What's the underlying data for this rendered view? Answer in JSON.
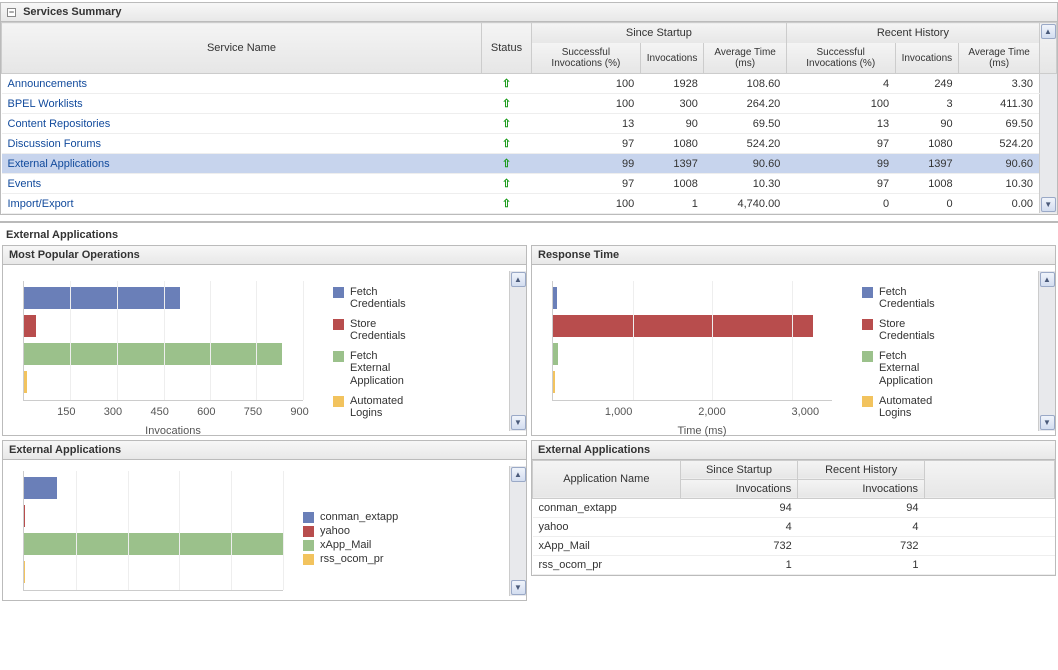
{
  "summary": {
    "title": "Services Summary",
    "columns": {
      "svc": "Service Name",
      "status": "Status",
      "since": "Since Startup",
      "recent": "Recent History",
      "succ": "Successful Invocations (%)",
      "inv": "Invocations",
      "avg": "Average Time (ms)"
    },
    "rows": [
      {
        "name": "Announcements",
        "succ_s": "100",
        "inv_s": "1928",
        "avg_s": "108.60",
        "succ_r": "4",
        "inv_r": "249",
        "avg_r": "3.30",
        "sel": false
      },
      {
        "name": "BPEL Worklists",
        "succ_s": "100",
        "inv_s": "300",
        "avg_s": "264.20",
        "succ_r": "100",
        "inv_r": "3",
        "avg_r": "411.30",
        "sel": false
      },
      {
        "name": "Content Repositories",
        "succ_s": "13",
        "inv_s": "90",
        "avg_s": "69.50",
        "succ_r": "13",
        "inv_r": "90",
        "avg_r": "69.50",
        "sel": false
      },
      {
        "name": "Discussion Forums",
        "succ_s": "97",
        "inv_s": "1080",
        "avg_s": "524.20",
        "succ_r": "97",
        "inv_r": "1080",
        "avg_r": "524.20",
        "sel": false
      },
      {
        "name": "External Applications",
        "succ_s": "99",
        "inv_s": "1397",
        "avg_s": "90.60",
        "succ_r": "99",
        "inv_r": "1397",
        "avg_r": "90.60",
        "sel": true
      },
      {
        "name": "Events",
        "succ_s": "97",
        "inv_s": "1008",
        "avg_s": "10.30",
        "succ_r": "97",
        "inv_r": "1008",
        "avg_r": "10.30",
        "sel": false
      },
      {
        "name": "Import/Export",
        "succ_s": "100",
        "inv_s": "1",
        "avg_s": "4,740.00",
        "succ_r": "0",
        "inv_r": "0",
        "avg_r": "0.00",
        "sel": false
      }
    ]
  },
  "section": {
    "title": "External Applications"
  },
  "popular": {
    "title": "Most Popular Operations",
    "axis": "Invocations",
    "ticks": [
      "150",
      "300",
      "450",
      "600",
      "750",
      "900"
    ],
    "legend": [
      {
        "cls": "c-fetch-cred",
        "label": "Fetch Credentials"
      },
      {
        "cls": "c-store-cred",
        "label": "Store Credentials"
      },
      {
        "cls": "c-fetch-ext",
        "label": "Fetch External Application"
      },
      {
        "cls": "c-auto-login",
        "label": "Automated Logins"
      }
    ]
  },
  "response": {
    "title": "Response Time",
    "axis": "Time (ms)",
    "ticks": [
      "1,000",
      "2,000",
      "3,000"
    ],
    "legend": [
      {
        "cls": "c-fetch-cred",
        "label": "Fetch Credentials"
      },
      {
        "cls": "c-store-cred",
        "label": "Store Credentials"
      },
      {
        "cls": "c-fetch-ext",
        "label": "Fetch External Application"
      },
      {
        "cls": "c-auto-login",
        "label": "Automated Logins"
      }
    ]
  },
  "extapps_chart": {
    "title": "External Applications",
    "legend": [
      {
        "cls": "c-conman",
        "label": "conman_extapp"
      },
      {
        "cls": "c-yahoo",
        "label": "yahoo"
      },
      {
        "cls": "c-xapp",
        "label": "xApp_Mail"
      },
      {
        "cls": "c-rss",
        "label": "rss_ocom_pr"
      }
    ]
  },
  "extapps_table": {
    "title": "External Applications",
    "cols": {
      "app": "Application Name",
      "since": "Since Startup",
      "recent": "Recent History",
      "inv": "Invocations"
    },
    "rows": [
      {
        "name": "conman_extapp",
        "s": "94",
        "r": "94"
      },
      {
        "name": "yahoo",
        "s": "4",
        "r": "4"
      },
      {
        "name": "xApp_Mail",
        "s": "732",
        "r": "732"
      },
      {
        "name": "rss_ocom_pr",
        "s": "1",
        "r": "1"
      }
    ]
  },
  "chart_data": [
    {
      "type": "bar",
      "orientation": "horizontal",
      "title": "Most Popular Operations",
      "xlabel": "Invocations",
      "xlim": [
        0,
        900
      ],
      "categories": [
        "Fetch Credentials",
        "Store Credentials",
        "Fetch External Application",
        "Automated Logins"
      ],
      "values": [
        500,
        40,
        830,
        10
      ],
      "colors": [
        "#6a7fb8",
        "#b84d4d",
        "#9bc18b",
        "#f2c35e"
      ]
    },
    {
      "type": "bar",
      "orientation": "horizontal",
      "title": "Response Time",
      "xlabel": "Time (ms)",
      "xlim": [
        0,
        3500
      ],
      "categories": [
        "Fetch Credentials",
        "Store Credentials",
        "Fetch External Application",
        "Automated Logins"
      ],
      "values": [
        50,
        3250,
        60,
        30
      ],
      "colors": [
        "#6a7fb8",
        "#b84d4d",
        "#9bc18b",
        "#f2c35e"
      ]
    },
    {
      "type": "bar",
      "orientation": "horizontal",
      "title": "External Applications",
      "categories": [
        "conman_extapp",
        "yahoo",
        "xApp_Mail",
        "rss_ocom_pr"
      ],
      "values": [
        94,
        4,
        732,
        1
      ],
      "colors": [
        "#6a7fb8",
        "#b84d4d",
        "#9bc18b",
        "#f2c35e"
      ]
    },
    {
      "type": "table",
      "title": "External Applications",
      "columns": [
        "Application Name",
        "Since Startup Invocations",
        "Recent History Invocations"
      ],
      "rows": [
        [
          "conman_extapp",
          94,
          94
        ],
        [
          "yahoo",
          4,
          4
        ],
        [
          "xApp_Mail",
          732,
          732
        ],
        [
          "rss_ocom_pr",
          1,
          1
        ]
      ]
    }
  ]
}
